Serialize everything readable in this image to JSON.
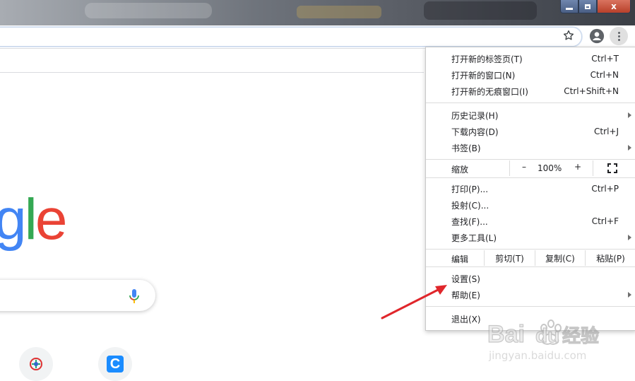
{
  "window": {
    "minimize_icon": "minimize-icon",
    "maximize_icon": "restore-icon",
    "close_label": "x"
  },
  "toolbar": {
    "bookmark_icon": "star-icon",
    "profile_icon": "account-icon",
    "menu_icon": "kebab-menu-icon"
  },
  "page": {
    "logo_visible_text": "gle",
    "mic_icon": "mic-icon",
    "shortcut_tiles": [
      "tile-1",
      "tile-2"
    ],
    "tile2_letter": "C"
  },
  "menu": {
    "group1": [
      {
        "label": "打开新的标签页(T)",
        "shortcut": "Ctrl+T"
      },
      {
        "label": "打开新的窗口(N)",
        "shortcut": "Ctrl+N"
      },
      {
        "label": "打开新的无痕窗口(I)",
        "shortcut": "Ctrl+Shift+N"
      }
    ],
    "group2": [
      {
        "label": "历史记录(H)",
        "shortcut": "",
        "submenu": true
      },
      {
        "label": "下载内容(D)",
        "shortcut": "Ctrl+J"
      },
      {
        "label": "书签(B)",
        "shortcut": "",
        "submenu": true
      }
    ],
    "zoom": {
      "label": "缩放",
      "minus": "–",
      "level": "100%",
      "plus": "+"
    },
    "group3": [
      {
        "label": "打印(P)...",
        "shortcut": "Ctrl+P"
      },
      {
        "label": "投射(C)...",
        "shortcut": ""
      },
      {
        "label": "查找(F)...",
        "shortcut": "Ctrl+F"
      },
      {
        "label": "更多工具(L)",
        "shortcut": "",
        "submenu": true
      }
    ],
    "edit": {
      "label": "编辑",
      "cut": "剪切(T)",
      "copy": "复制(C)",
      "paste": "粘贴(P)"
    },
    "group4": [
      {
        "label": "设置(S)",
        "shortcut": ""
      },
      {
        "label": "帮助(E)",
        "shortcut": "",
        "submenu": true
      }
    ],
    "exit": {
      "label": "退出(X)"
    }
  },
  "watermark": {
    "brand": "Bai",
    "brand2": "du",
    "suffix": "经验",
    "url": "jingyan.baidu.com"
  },
  "colors": {
    "annotation_arrow": "#e0262b",
    "google_blue": "#4285f4",
    "google_green": "#34a853",
    "google_red": "#ea4335"
  }
}
